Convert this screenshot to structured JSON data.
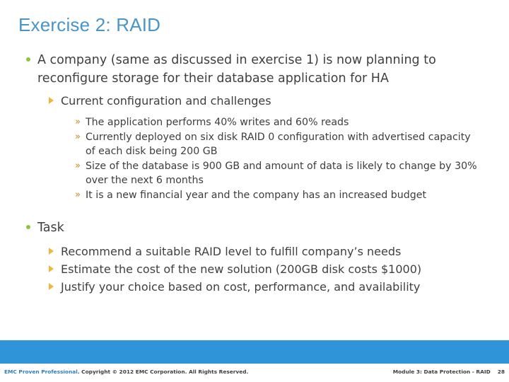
{
  "slide": {
    "title": "Exercise 2: RAID",
    "title_color": "#4a95c8",
    "background": "#ffffff",
    "accent_band_color": "#3095d8",
    "bullet_level1_color": "#8cc63e",
    "bullet_level2_color": "#f3b63c",
    "bullet_level3_color": "#c28a1c"
  },
  "content": {
    "bullet1": {
      "text": "A company (same as discussed in exercise 1) is now planning to reconfigure storage for their database application for HA",
      "sub": {
        "heading": "Current configuration and challenges",
        "items": [
          "The application performs 40% writes and 60% reads",
          "Currently deployed on six disk RAID 0 configuration with advertised capacity of each disk being 200 GB",
          "Size of the database is 900 GB and amount of data is likely to change by 30% over the next 6 months",
          "It is a new financial year and the company has an increased budget"
        ]
      }
    },
    "bullet2": {
      "text": "Task",
      "items": [
        "Recommend a suitable RAID level to fulfill company’s needs",
        "Estimate the cost of the new solution (200GB disk costs $1000)",
        "Justify your choice based on cost, performance, and availability"
      ]
    }
  },
  "icons": {
    "chevron_double": "»"
  },
  "footer": {
    "brand": "EMC Proven Professional",
    "copyright": ". Copyright © 2012 EMC Corporation. All Rights Reserved.",
    "module": "Module 3: Data Protection - RAID",
    "page_number": "28"
  }
}
